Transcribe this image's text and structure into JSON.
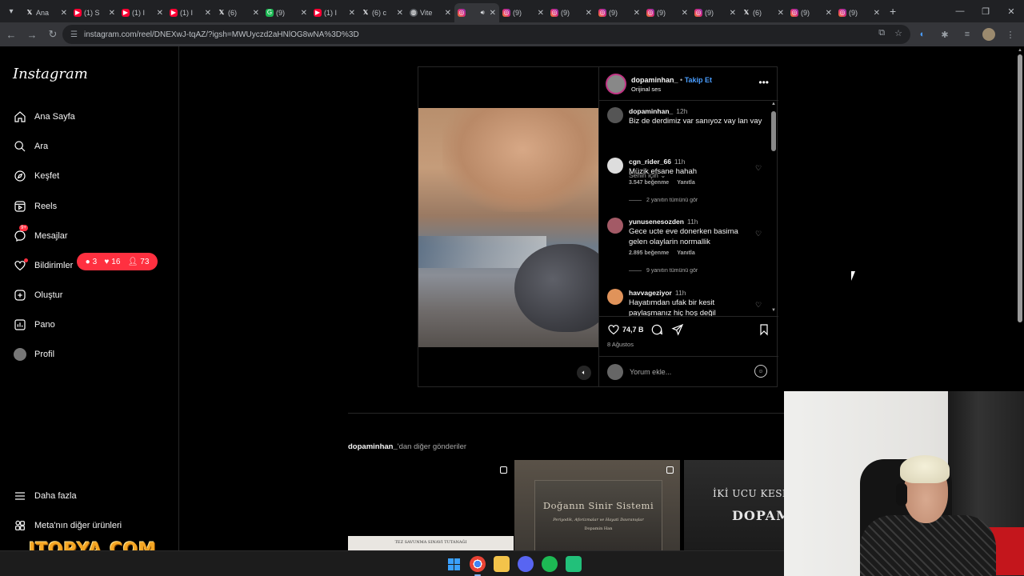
{
  "browser": {
    "tabs": [
      {
        "icon": "x-icon",
        "title": "Ana"
      },
      {
        "icon": "youtube-icon",
        "title": "(1) S"
      },
      {
        "icon": "youtube-icon",
        "title": "(1) I"
      },
      {
        "icon": "youtube-icon",
        "title": "(1) I"
      },
      {
        "icon": "x-icon",
        "title": "(6) "
      },
      {
        "icon": "grammarly-icon",
        "title": "(9) "
      },
      {
        "icon": "youtube-icon",
        "title": "(1) I"
      },
      {
        "icon": "x-icon",
        "title": "(6) c"
      },
      {
        "icon": "globe-icon",
        "title": "Vite"
      },
      {
        "icon": "instagram-icon",
        "title": "",
        "active": true
      },
      {
        "icon": "instagram-icon",
        "title": "(9) "
      },
      {
        "icon": "instagram-icon",
        "title": "(9) "
      },
      {
        "icon": "instagram-icon",
        "title": "(9) "
      },
      {
        "icon": "instagram-icon",
        "title": "(9) "
      },
      {
        "icon": "instagram-icon",
        "title": "(9) "
      },
      {
        "icon": "x-icon",
        "title": "(6) "
      },
      {
        "icon": "instagram-icon",
        "title": "(9) "
      },
      {
        "icon": "instagram-icon",
        "title": "(9) "
      }
    ],
    "url": "instagram.com/reel/DNEXwJ-tqAZ/?igsh=MWUyczd2aHNlOG8wNA%3D%3D"
  },
  "sidebar": {
    "logo": "Instagram",
    "items": [
      {
        "label": "Ana Sayfa",
        "icon": "home-icon"
      },
      {
        "label": "Ara",
        "icon": "search-icon"
      },
      {
        "label": "Keşfet",
        "icon": "compass-icon"
      },
      {
        "label": "Reels",
        "icon": "reels-icon"
      },
      {
        "label": "Mesajlar",
        "icon": "messenger-icon",
        "badge": "9+"
      },
      {
        "label": "Bildirimler",
        "icon": "heart-icon"
      },
      {
        "label": "Oluştur",
        "icon": "plus-square-icon"
      },
      {
        "label": "Pano",
        "icon": "chart-icon"
      },
      {
        "label": "Profil",
        "icon": "avatar"
      }
    ],
    "more": "Daha fazla",
    "meta": "Meta'nın diğer ürünleri",
    "notifications": {
      "comments": "3",
      "likes": "16",
      "follows": "73"
    }
  },
  "post": {
    "username": "dopaminhan_",
    "separator": "•",
    "follow": "Takip Et",
    "audio": "Orijinal ses",
    "caption": {
      "user": "dopaminhan_",
      "time": "12h",
      "text": "Biz de derdimiz var sanıyoz vay lan vay"
    },
    "sort_label": "Senin için",
    "comments": [
      {
        "user": "cgn_rider_66",
        "time": "11h",
        "text": "Müzik efsane hahah",
        "likes": "3.547 beğenme",
        "reply": "Yanıtla",
        "replies": "2 yanıtın tümünü gör"
      },
      {
        "user": "yunusenesozden",
        "time": "11h",
        "text": "Gece ucte eve donerken basima gelen olaylarin normallik",
        "likes": "2.895 beğenme",
        "reply": "Yanıtla",
        "replies": "9 yanıtın tümünü gör"
      },
      {
        "user": "havvageziyor",
        "time": "11h",
        "text": "Hayatımdan ufak bir kesit paylaşmanız hiç hoş değil"
      }
    ],
    "like_count": "74,7 B",
    "date": "8 Ağustos",
    "comment_placeholder": "Yorum ekle..."
  },
  "more_posts": {
    "user": "dopaminhan_",
    "suffix": "'dan diğer gönderiler",
    "thumbs": [
      {
        "text": "TEZ SAVUNMA SINAVI TUTANAĞI"
      },
      {
        "title": "Doğanın Sinir Sistemi",
        "subtitle": "Periyodik, Aforizmalar ve Hayati Davranışlar",
        "author": "Dopamin Han"
      },
      {
        "line1": "İKİ UCU KESKİN",
        "line2": "DOPAM"
      }
    ]
  },
  "watermark": "ITOPYA.COM"
}
